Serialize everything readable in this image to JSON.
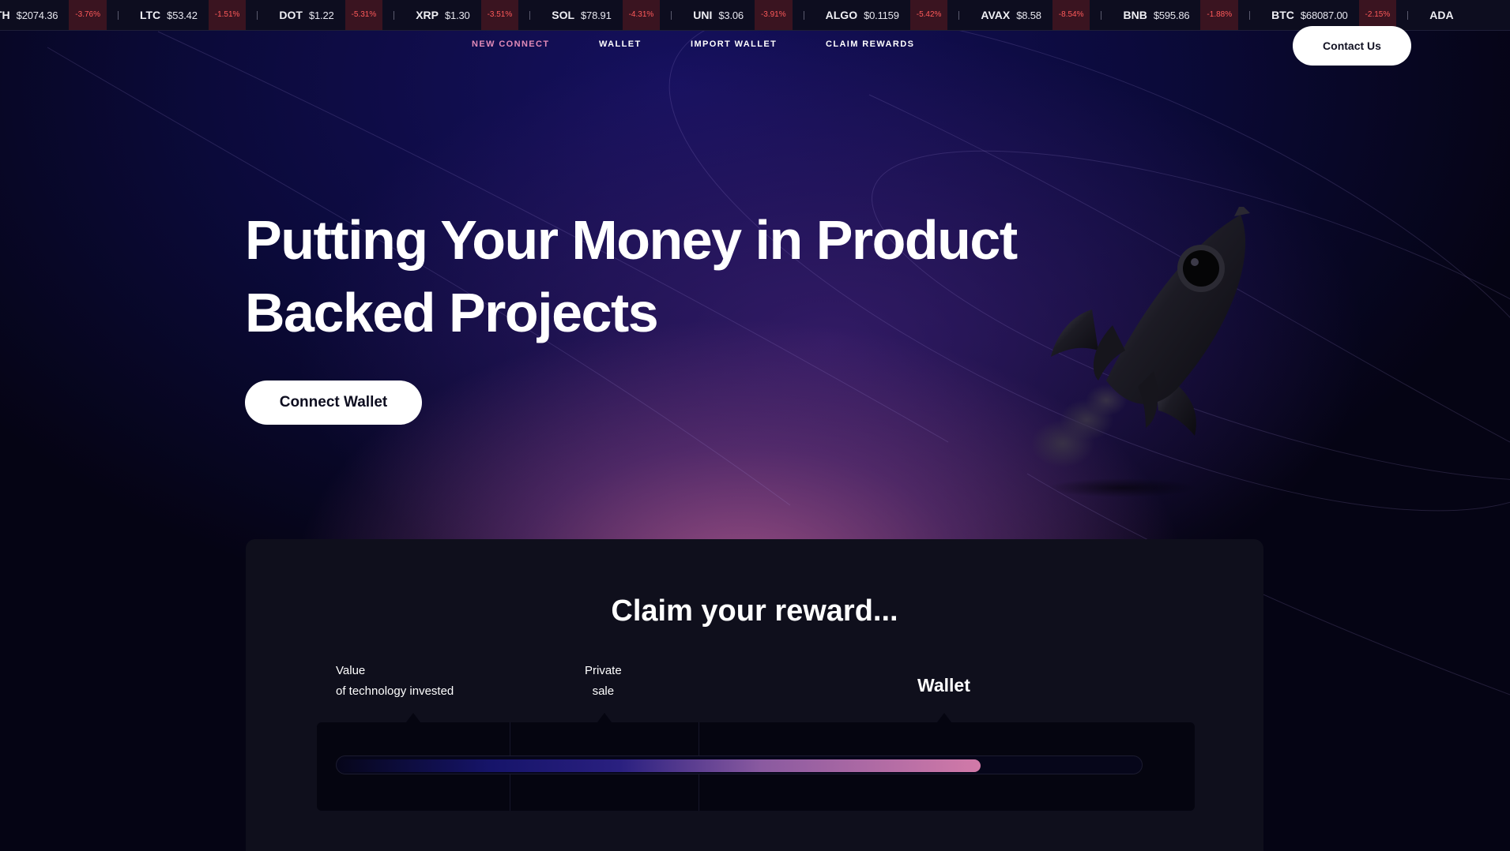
{
  "ticker": [
    {
      "symbol": "TH",
      "price": "$2074.36",
      "change": "-3.76%"
    },
    {
      "symbol": "LTC",
      "price": "$53.42",
      "change": "-1.51%"
    },
    {
      "symbol": "DOT",
      "price": "$1.22",
      "change": "-5.31%"
    },
    {
      "symbol": "XRP",
      "price": "$1.30",
      "change": "-3.51%"
    },
    {
      "symbol": "SOL",
      "price": "$78.91",
      "change": "-4.31%"
    },
    {
      "symbol": "UNI",
      "price": "$3.06",
      "change": "-3.91%"
    },
    {
      "symbol": "ALGO",
      "price": "$0.1159",
      "change": "-5.42%"
    },
    {
      "symbol": "AVAX",
      "price": "$8.58",
      "change": "-8.54%"
    },
    {
      "symbol": "BNB",
      "price": "$595.86",
      "change": "-1.88%"
    },
    {
      "symbol": "BTC",
      "price": "$68087.00",
      "change": "-2.15%"
    },
    {
      "symbol": "ADA",
      "price": "",
      "change": ""
    }
  ],
  "nav": {
    "new_connect": "NEW CONNECT",
    "wallet": "WALLET",
    "import_wallet": "IMPORT WALLET",
    "claim_rewards": "CLAIM REWARDS"
  },
  "contact_button": "Contact Us",
  "hero": {
    "title_line1": "Putting Your Money in Product",
    "title_line2": "Backed Projects",
    "connect_button": "Connect Wallet"
  },
  "reward": {
    "title": "Claim your reward...",
    "steps": [
      {
        "line1": "Value",
        "line2": "of technology invested"
      },
      {
        "line1": "Private",
        "line2": "sale"
      },
      {
        "line1": "Wallet",
        "line2": ""
      }
    ],
    "progress_fraction": 0.8
  },
  "colors": {
    "active_nav": "#e28bb8",
    "negative_change": "#ff5a5a",
    "progress_end": "#d27aa8"
  },
  "icons": {
    "hero_illustration": "rocket-icon"
  }
}
